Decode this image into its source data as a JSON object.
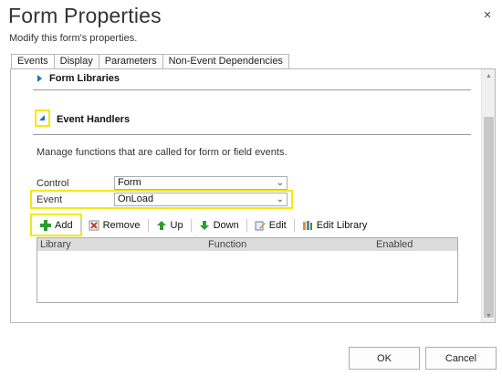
{
  "dialog": {
    "title": "Form Properties",
    "subtitle": "Modify this form's properties.",
    "close_icon": "×"
  },
  "tabs": [
    {
      "label": "Events",
      "active": true
    },
    {
      "label": "Display",
      "active": false
    },
    {
      "label": "Parameters",
      "active": false
    },
    {
      "label": "Non-Event Dependencies",
      "active": false
    }
  ],
  "sections": {
    "form_libraries": "Form Libraries",
    "event_handlers": "Event Handlers",
    "event_handlers_desc": "Manage functions that are called for form or field events."
  },
  "fields": {
    "control_label": "Control",
    "control_value": "Form",
    "event_label": "Event",
    "event_value": "OnLoad"
  },
  "toolbar": {
    "add": "Add",
    "remove": "Remove",
    "up": "Up",
    "down": "Down",
    "edit": "Edit",
    "edit_library": "Edit Library"
  },
  "grid": {
    "columns": [
      "Library",
      "Function",
      "Enabled"
    ],
    "rows": []
  },
  "footer": {
    "ok": "OK",
    "cancel": "Cancel"
  },
  "colors": {
    "highlight": "#f5e80c",
    "accent": "#1f6fc5",
    "add_icon": "#2e9b2e",
    "remove_icon": "#c23a2b"
  }
}
